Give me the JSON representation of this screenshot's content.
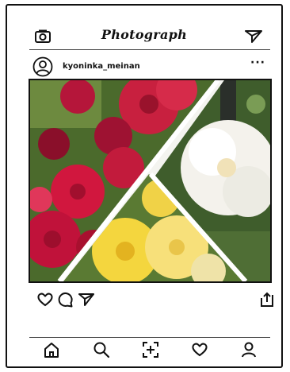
{
  "app": {
    "title": "Photograph"
  },
  "post": {
    "username": "kyoninka_meinan",
    "more_label": "···"
  },
  "icons": {
    "camera": "camera-icon",
    "send": "paper-plane-icon",
    "avatar": "user-avatar-icon",
    "like": "heart-icon",
    "comment": "comment-bubble-icon",
    "share": "paper-plane-icon",
    "save": "share-upload-icon",
    "home": "home-icon",
    "search": "search-icon",
    "add": "add-post-icon",
    "activity": "heart-icon",
    "profile": "profile-icon"
  },
  "colors": {
    "ink": "#111111",
    "red_rose": "#c81e3a",
    "white_rose": "#f3f1ea",
    "yellow_rose": "#f2d34a",
    "foliage": "#3e5a2a"
  }
}
